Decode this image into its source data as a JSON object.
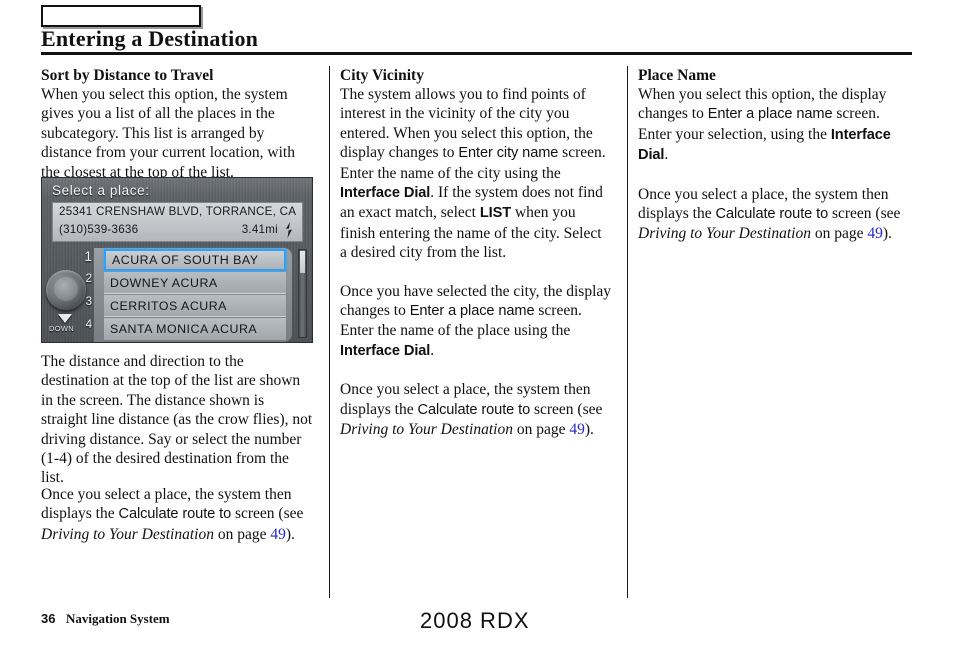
{
  "header": {
    "tab_box_label": "",
    "title": "Entering a Destination"
  },
  "columns": {
    "left": {
      "heading": "Sort by Distance to Travel",
      "para1": "When you select this option, the system gives you a list of all the places in the subcategory. This list is arranged by distance from your current location, with the closest at the top of the list.",
      "para2": "The distance and direction to the destination at the top of the list are shown in the screen. The distance shown is straight line distance (as the crow flies), not driving distance. Say or select the number (1-4) of the desired destination from the list.",
      "para3": {
        "t1": "Once you select a place, the system then displays the ",
        "screen_term": "Calculate route to",
        "t2": " screen (see ",
        "ref_title": "Driving to Your Destination",
        "t3": " on page ",
        "page_ref": "49",
        "t4": ")."
      }
    },
    "middle": {
      "heading": "City Vicinity",
      "para1": {
        "t1": "The system allows you to find points of interest in the vicinity of the city you entered. When you select this option, the display changes to ",
        "screen_term": "Enter city name",
        "t2": " screen. Enter the name of the city using the ",
        "control_term": "Interface Dial",
        "t3": ". If the system does not find an exact match, select ",
        "button_term": "LIST",
        "t4": " when you finish entering the name of the city. Select a desired city from the list."
      },
      "para2": {
        "t1": "Once you have selected the city, the display changes to ",
        "screen_term": "Enter a place name",
        "t2": " screen. Enter the name of the place using the ",
        "control_term": "Interface Dial",
        "t3": "."
      },
      "para3": {
        "t1": "Once you select a place, the system then displays the ",
        "screen_term": "Calculate route to",
        "t2": " screen (see ",
        "ref_title": "Driving to Your Destination",
        "t3": " on page ",
        "page_ref": "49",
        "t4": ")."
      }
    },
    "right": {
      "heading": "Place Name",
      "para1": {
        "t1": "When you select this option, the display changes to ",
        "screen_term": "Enter a place name",
        "t2": " screen. Enter your selection, using the ",
        "control_term": "Interface Dial",
        "t3": "."
      },
      "para2": {
        "t1": "Once you select a place, the system then displays the ",
        "screen_term": "Calculate route to",
        "t2": " screen (see ",
        "ref_title": "Driving to Your Destination",
        "t3": " on page ",
        "page_ref": "49",
        "t4": ")."
      }
    }
  },
  "nav_screenshot": {
    "title": "Select a place:",
    "address_line1": "25341 CRENSHAW BLVD, TORRANCE, CA",
    "address_line2": "(310)539-3636",
    "distance": "3.41mi",
    "direction_icon": "direction-arrow-icon",
    "dial_icon": "interface-dial-icon",
    "down_label": "DOWN",
    "list": [
      {
        "number": "1",
        "name": "ACURA OF SOUTH BAY",
        "selected": true
      },
      {
        "number": "2",
        "name": "DOWNEY ACURA",
        "selected": false
      },
      {
        "number": "3",
        "name": "CERRITOS ACURA",
        "selected": false
      },
      {
        "number": "4",
        "name": "SANTA MONICA ACURA",
        "selected": false
      }
    ],
    "highlight_color": "#2aa3ff"
  },
  "footer": {
    "page_number": "36",
    "section": "Navigation System",
    "model": "2008  RDX"
  }
}
